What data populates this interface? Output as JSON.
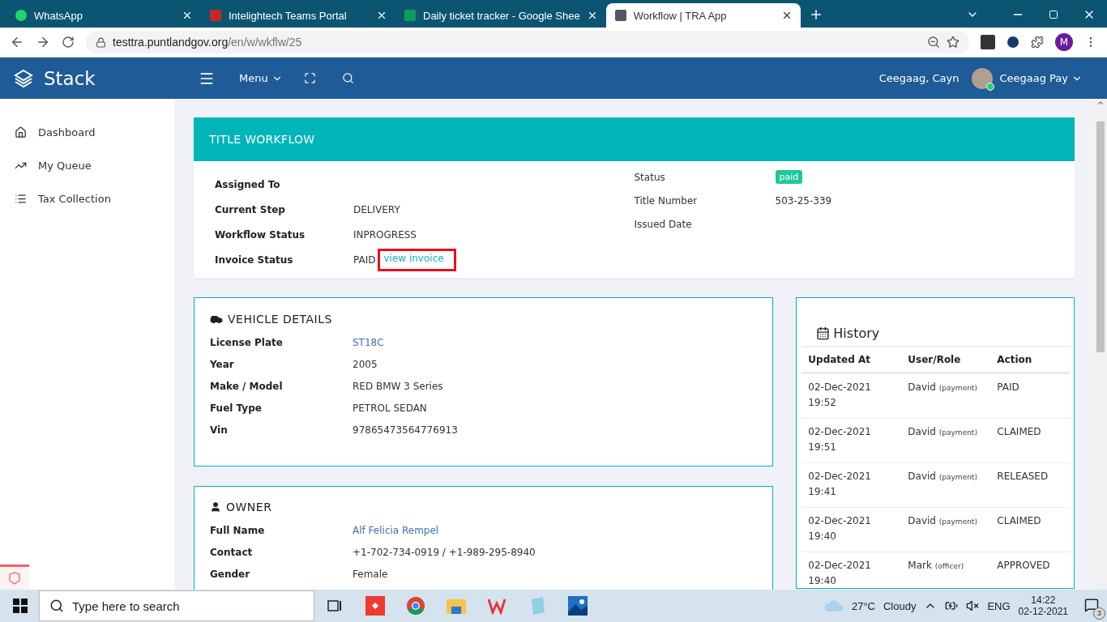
{
  "browser": {
    "tabs": [
      {
        "title": "WhatsApp",
        "selected": false
      },
      {
        "title": "Intelightech Teams Portal",
        "selected": false
      },
      {
        "title": "Daily ticket tracker - Google Shee",
        "selected": false
      },
      {
        "title": "Workflow | TRA App",
        "selected": true
      }
    ],
    "url": {
      "host": "testtra.puntlandgov.org",
      "path": "/en/w/wkflw/25"
    },
    "profile_letter": "M"
  },
  "header": {
    "brand": "Stack",
    "menu": "Menu",
    "user_name": "Ceegaag, Cayn",
    "account": "Ceegaag Pay"
  },
  "sidebar": {
    "items": [
      {
        "label": "Dashboard",
        "kind": "home"
      },
      {
        "label": "My Queue",
        "kind": "trend"
      },
      {
        "label": "Tax Collection",
        "kind": "list"
      }
    ]
  },
  "workflow": {
    "title": "TITLE WORKFLOW",
    "left": [
      {
        "label": "Assigned To"
      },
      {
        "label": "Current Step",
        "value": "DELIVERY"
      },
      {
        "label": "Workflow Status",
        "value": "INPROGRESS"
      },
      {
        "label": "Invoice Status",
        "value": "PAID",
        "link": "view invoice",
        "highlighted": true
      }
    ],
    "right": [
      {
        "label": "Status",
        "value": "paid",
        "kind": "badge"
      },
      {
        "label": "Title Number",
        "value": "503-25-339",
        "kind": "text"
      },
      {
        "label": "Issued Date",
        "kind": "text"
      }
    ]
  },
  "vehicle": {
    "title": "VEHICLE DETAILS",
    "rows": [
      {
        "label": "License Plate",
        "value": "ST18C",
        "kind": "link"
      },
      {
        "label": "Year",
        "value": "2005",
        "kind": "text"
      },
      {
        "label": "Make / Model",
        "value": "RED BMW 3 Series",
        "kind": "text"
      },
      {
        "label": "Fuel Type",
        "value": "PETROL SEDAN",
        "kind": "text"
      },
      {
        "label": "Vin",
        "value": "97865473564776913",
        "kind": "text"
      }
    ]
  },
  "owner": {
    "title": "OWNER",
    "rows": [
      {
        "label": "Full Name",
        "value": "Alf Felicia Rempel",
        "kind": "link"
      },
      {
        "label": "Contact",
        "value": "+1-702-734-0919 / +1-989-295-8940",
        "kind": "text"
      },
      {
        "label": "Gender",
        "value": "Female",
        "kind": "text"
      }
    ]
  },
  "history": {
    "title": "History",
    "columns": [
      "Updated At",
      "User/Role",
      "Action"
    ],
    "rows": [
      {
        "date": "02-Dec-2021",
        "time": "19:52",
        "user": "David",
        "role": "(payment)",
        "action": "PAID"
      },
      {
        "date": "02-Dec-2021",
        "time": "19:51",
        "user": "David",
        "role": "(payment)",
        "action": "CLAIMED"
      },
      {
        "date": "02-Dec-2021",
        "time": "19:41",
        "user": "David",
        "role": "(payment)",
        "action": "RELEASED"
      },
      {
        "date": "02-Dec-2021",
        "time": "19:40",
        "user": "David",
        "role": "(payment)",
        "action": "CLAIMED"
      },
      {
        "date": "02-Dec-2021",
        "time": "19:40",
        "user": "Mark",
        "role": "(officer)",
        "action": "APPROVED"
      }
    ]
  },
  "taskbar": {
    "search_placeholder": "Type here to search",
    "temperature": "27°C",
    "weather": "Cloudy",
    "language": "ENG",
    "time": "14:22",
    "date": "02-12-2021",
    "notifications": "3"
  }
}
